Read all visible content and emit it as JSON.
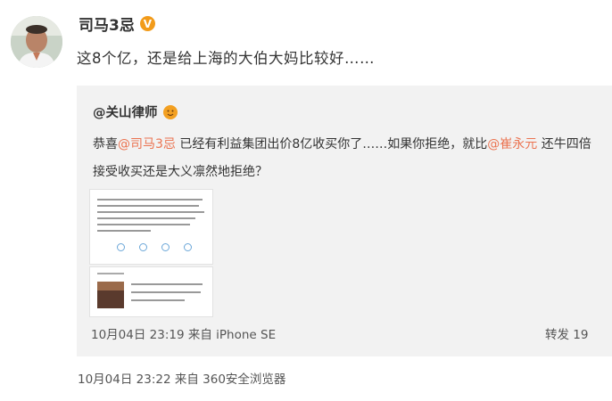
{
  "post": {
    "author": "司马3忌",
    "verified_badge": "V",
    "text": "这8个亿，还是给上海的大伯大妈比较好……",
    "meta": "10月04日 23:22 来自 360安全浏览器"
  },
  "repost": {
    "author": "@关山律师",
    "line1_prefix": "恭喜",
    "mention1": "@司马3忌",
    "line1_mid": " 已经有利益集团出价8亿收买你了……如果你拒绝，就比",
    "mention2": "@崔永元",
    "line1_suffix": " 还牛四倍",
    "line2": "接受收买还是大义凛然地拒绝？",
    "meta": "10月04日 23:19 来自 iPhone SE",
    "share": "转发 19"
  },
  "colors": {
    "mention": "#eb7350",
    "badge": "#f29b1a",
    "repost_bg": "#f2f2f2"
  },
  "icons": {
    "verified": "verified-badge-icon",
    "author_badge": "emoji-icon"
  }
}
